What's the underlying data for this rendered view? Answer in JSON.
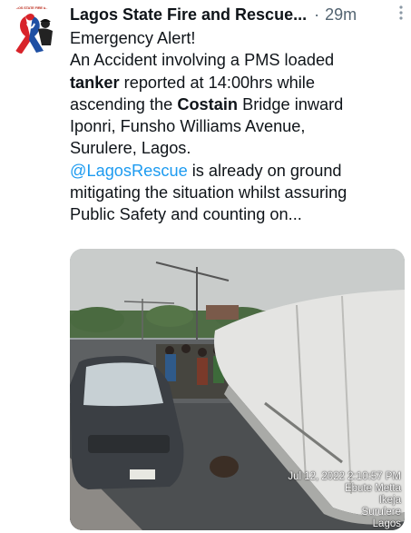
{
  "tweet": {
    "author_name": "Lagos State Fire and Rescue...",
    "separator": "·",
    "timestamp": "29m",
    "avatar_caption": "LAGOS STATE FIRE & RESCUE",
    "text": {
      "line1": "Emergency Alert!",
      "line2": "An Accident involving a PMS  loaded",
      "line3_bold": "tanker",
      "line3_rest": " reported at 14:00hrs while",
      "line4_pre": "ascending the ",
      "line4_bold": "Costain",
      "line4_post": " Bridge inward",
      "line5": "Iponri, Funsho Williams Avenue,",
      "line6": "Surulere, Lagos.",
      "mention": "@LagosRescue",
      "line7_rest": " is already on ground",
      "line8": "mitigating the situation whilst assuring",
      "line9": "Public Safety and counting on..."
    },
    "media": {
      "photo_stamp": {
        "date": "Jul 12, 2022 2:10:57 PM",
        "line2": "Ebute Metta",
        "line3": "Ikeja",
        "line4": "Surulere",
        "line5": "Lagos"
      }
    }
  },
  "icons": {
    "more": "more-options-icon",
    "avatar": "fire-rescue-ribbon-logo"
  },
  "colors": {
    "text": "#0f1419",
    "secondary": "#536471",
    "link": "#1d9bf0"
  }
}
